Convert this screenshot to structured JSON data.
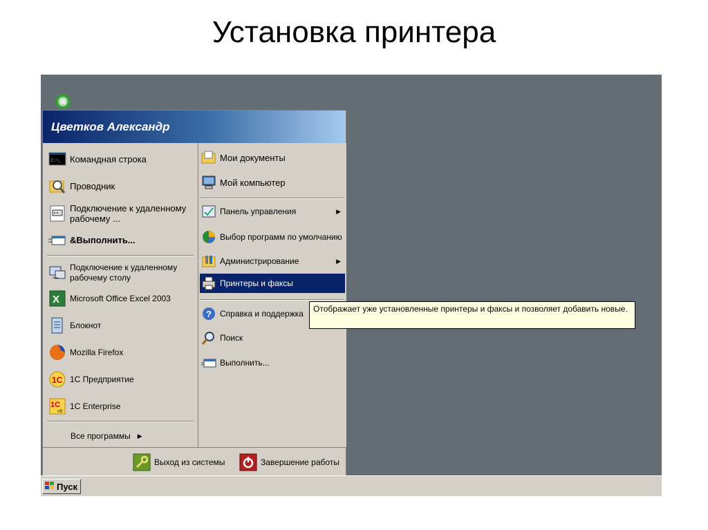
{
  "slide": {
    "title": "Установка принтера"
  },
  "start_menu": {
    "user_name": "Цветков Александр",
    "left_items": [
      {
        "label": "Командная строка",
        "icon": "cmd-icon"
      },
      {
        "label": "Проводник",
        "icon": "explorer-icon"
      },
      {
        "label": "Подключение к удаленному рабочему ...",
        "icon": "remote-desktop-icon"
      },
      {
        "label": "&Выполнить...",
        "icon": "run-icon"
      },
      {
        "label": "Подключение к удаленному рабочему столу",
        "icon": "remote-desktop-icon"
      },
      {
        "label": "Microsoft Office Excel 2003",
        "icon": "excel-icon"
      },
      {
        "label": "Блокнот",
        "icon": "notepad-icon"
      },
      {
        "label": "Mozilla Firefox",
        "icon": "firefox-icon"
      },
      {
        "label": "1С Предприятие",
        "icon": "1c-icon"
      },
      {
        "label": "1C Enterprise",
        "icon": "1c-v8-icon"
      }
    ],
    "all_programs": "Все программы",
    "right_items": [
      {
        "label": "Мои документы",
        "icon": "documents-icon"
      },
      {
        "label": "Мой компьютер",
        "icon": "computer-icon"
      },
      {
        "label": "Панель управления",
        "icon": "control-panel-icon"
      },
      {
        "label": "Выбор программ по умолчанию",
        "icon": "default-programs-icon"
      },
      {
        "label": "Администрирование",
        "icon": "admin-tools-icon"
      },
      {
        "label": "Принтеры и факсы",
        "icon": "printer-icon"
      },
      {
        "label": "Справка и поддержка",
        "icon": "help-icon"
      },
      {
        "label": "Поиск",
        "icon": "search-icon"
      },
      {
        "label": "Выполнить...",
        "icon": "run-icon"
      }
    ],
    "logoff": "Выход из системы",
    "shutdown": "Завершение работы"
  },
  "tooltip": {
    "text": "Отображает уже установленные принтеры и факсы и позволяет добавить новые."
  },
  "taskbar": {
    "start_label": "Пуск"
  },
  "colors": {
    "desktop": "#646d73",
    "highlight": "#0a246a",
    "menu_bg": "#d4d0c8",
    "tooltip_bg": "#ffffe1"
  }
}
